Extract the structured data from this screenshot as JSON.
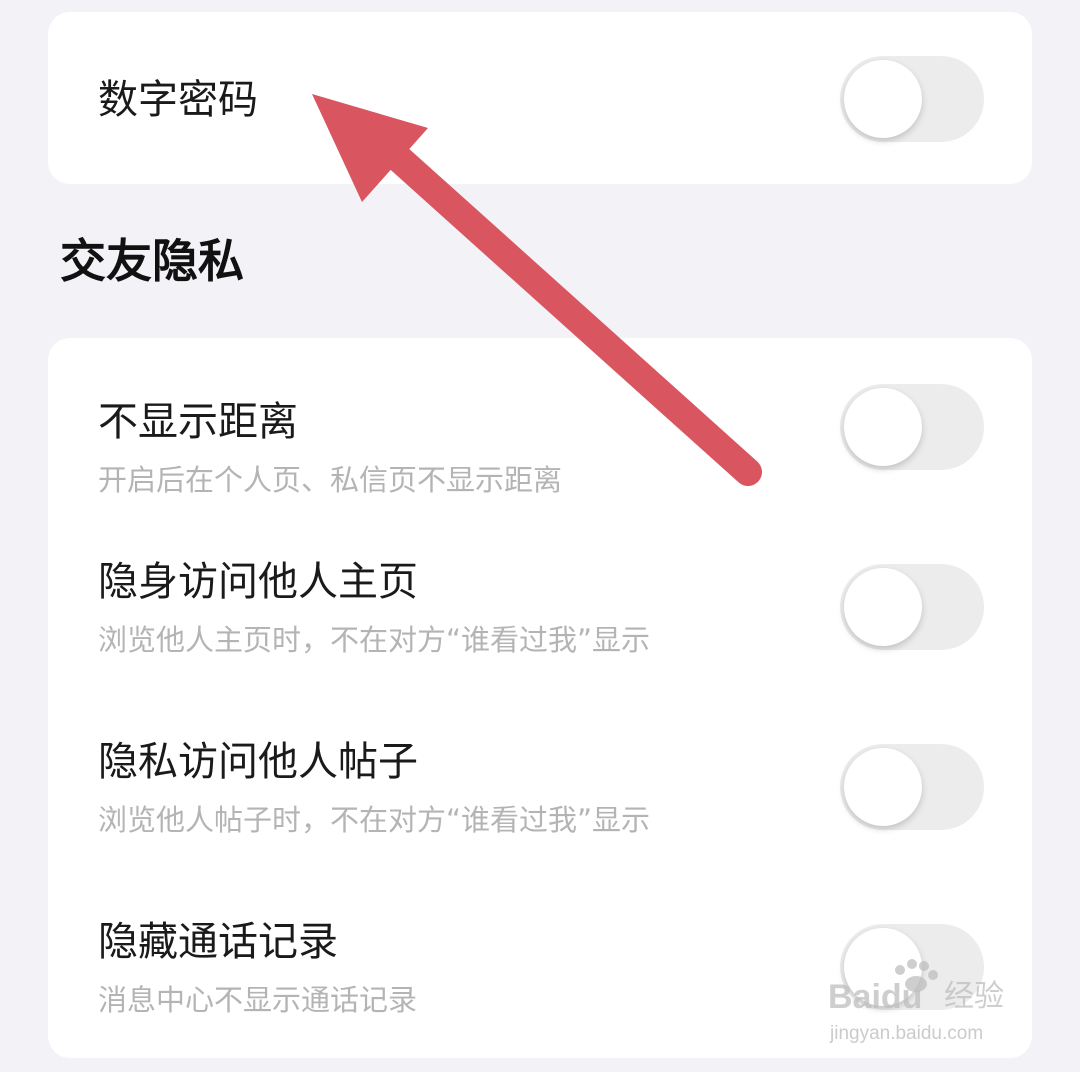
{
  "password_card": {
    "rows": [
      {
        "title": "数字密码",
        "enabled": false
      }
    ]
  },
  "social_privacy": {
    "section_title": "交友隐私",
    "rows": [
      {
        "title": "不显示距离",
        "subtitle": "开启后在个人页、私信页不显示距离",
        "enabled": false
      },
      {
        "title": "隐身访问他人主页",
        "subtitle": "浏览他人主页时，不在对方“谁看过我”显示",
        "enabled": false
      },
      {
        "title": "隐私访问他人帖子",
        "subtitle": "浏览他人帖子时，不在对方“谁看过我”显示",
        "enabled": false
      },
      {
        "title": "隐藏通话记录",
        "subtitle": "消息中心不显示通话记录",
        "enabled": false
      }
    ]
  },
  "annotation": {
    "arrow_color": "#d95560",
    "arrow_icon": "red-arrow-icon"
  },
  "watermark": {
    "brand": "Baidu",
    "product": "经验",
    "url": "jingyan.baidu.com",
    "icon": "paw-icon"
  },
  "colors": {
    "background": "#f2f2f7",
    "card": "#ffffff",
    "toggle_track_off": "#ececec",
    "title_text": "#1a1a1a",
    "subtitle_text": "#b4b4b4"
  }
}
